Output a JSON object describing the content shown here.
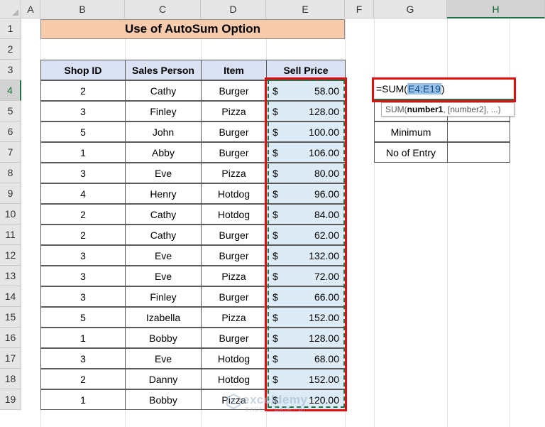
{
  "columns": [
    "A",
    "B",
    "C",
    "D",
    "E",
    "F",
    "G",
    "H"
  ],
  "active_column": "H",
  "rows": [
    "1",
    "2",
    "3",
    "4",
    "5",
    "6",
    "7",
    "8",
    "9",
    "10",
    "11",
    "12",
    "13",
    "14",
    "15",
    "16",
    "17",
    "18",
    "19"
  ],
  "active_row": "4",
  "title": "Use of AutoSum Option",
  "table": {
    "headers": [
      "Shop ID",
      "Sales Person",
      "Item",
      "Sell Price"
    ],
    "currency_symbol": "$",
    "rows": [
      {
        "shop_id": "2",
        "sales_person": "Cathy",
        "item": "Burger",
        "price": "58.00"
      },
      {
        "shop_id": "3",
        "sales_person": "Finley",
        "item": "Pizza",
        "price": "128.00"
      },
      {
        "shop_id": "5",
        "sales_person": "John",
        "item": "Burger",
        "price": "100.00"
      },
      {
        "shop_id": "1",
        "sales_person": "Abby",
        "item": "Burger",
        "price": "106.00"
      },
      {
        "shop_id": "3",
        "sales_person": "Eve",
        "item": "Pizza",
        "price": "80.00"
      },
      {
        "shop_id": "4",
        "sales_person": "Henry",
        "item": "Hotdog",
        "price": "96.00"
      },
      {
        "shop_id": "2",
        "sales_person": "Cathy",
        "item": "Hotdog",
        "price": "84.00"
      },
      {
        "shop_id": "2",
        "sales_person": "Cathy",
        "item": "Burger",
        "price": "62.00"
      },
      {
        "shop_id": "3",
        "sales_person": "Eve",
        "item": "Burger",
        "price": "132.00"
      },
      {
        "shop_id": "3",
        "sales_person": "Eve",
        "item": "Pizza",
        "price": "72.00"
      },
      {
        "shop_id": "3",
        "sales_person": "Finley",
        "item": "Burger",
        "price": "66.00"
      },
      {
        "shop_id": "5",
        "sales_person": "Izabella",
        "item": "Pizza",
        "price": "152.00"
      },
      {
        "shop_id": "1",
        "sales_person": "Bobby",
        "item": "Burger",
        "price": "128.00"
      },
      {
        "shop_id": "3",
        "sales_person": "Eve",
        "item": "Hotdog",
        "price": "68.00"
      },
      {
        "shop_id": "2",
        "sales_person": "Danny",
        "item": "Hotdog",
        "price": "152.00"
      },
      {
        "shop_id": "1",
        "sales_person": "Bobby",
        "item": "Pizza",
        "price": "120.00"
      }
    ]
  },
  "side_table": {
    "formula_prefix": "=SUM(",
    "formula_ref": "E4:E19",
    "formula_suffix": ")",
    "labels": [
      "",
      "Minimum",
      "No of Entry"
    ]
  },
  "tooltip": {
    "func": "SUM(",
    "arg1": "number1",
    "rest": ", [number2], ...)"
  },
  "watermark": {
    "text": "exceldemy",
    "sub": "EXCEL · DATA · BI"
  },
  "colors": {
    "title_fill": "#f8cbad",
    "header_fill": "#d9e1f2",
    "price_fill": "#ddebf7",
    "highlight_border": "#e01010",
    "selection": "#217346"
  }
}
